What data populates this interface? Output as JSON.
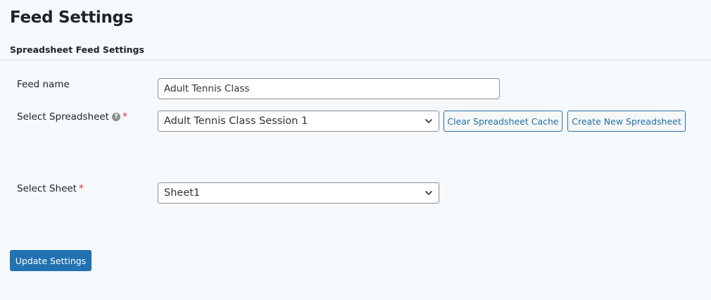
{
  "page": {
    "title": "Feed Settings"
  },
  "section": {
    "title": "Spreadsheet Feed Settings"
  },
  "fields": {
    "feed_name": {
      "label": "Feed name",
      "value": "Adult Tennis Class"
    },
    "spreadsheet": {
      "label": "Select Spreadsheet",
      "help_icon": "question-circle-icon",
      "required_mark": "*",
      "selected": "Adult Tennis Class Session 1"
    },
    "sheet": {
      "label": "Select Sheet",
      "required_mark": "*",
      "selected": "Sheet1"
    }
  },
  "buttons": {
    "clear_cache": "Clear Spreadsheet Cache",
    "create_new": "Create New Spreadsheet",
    "update": "Update Settings"
  },
  "colors": {
    "accent": "#2271b1",
    "required": "#d63638",
    "background": "#f5f9fc"
  }
}
